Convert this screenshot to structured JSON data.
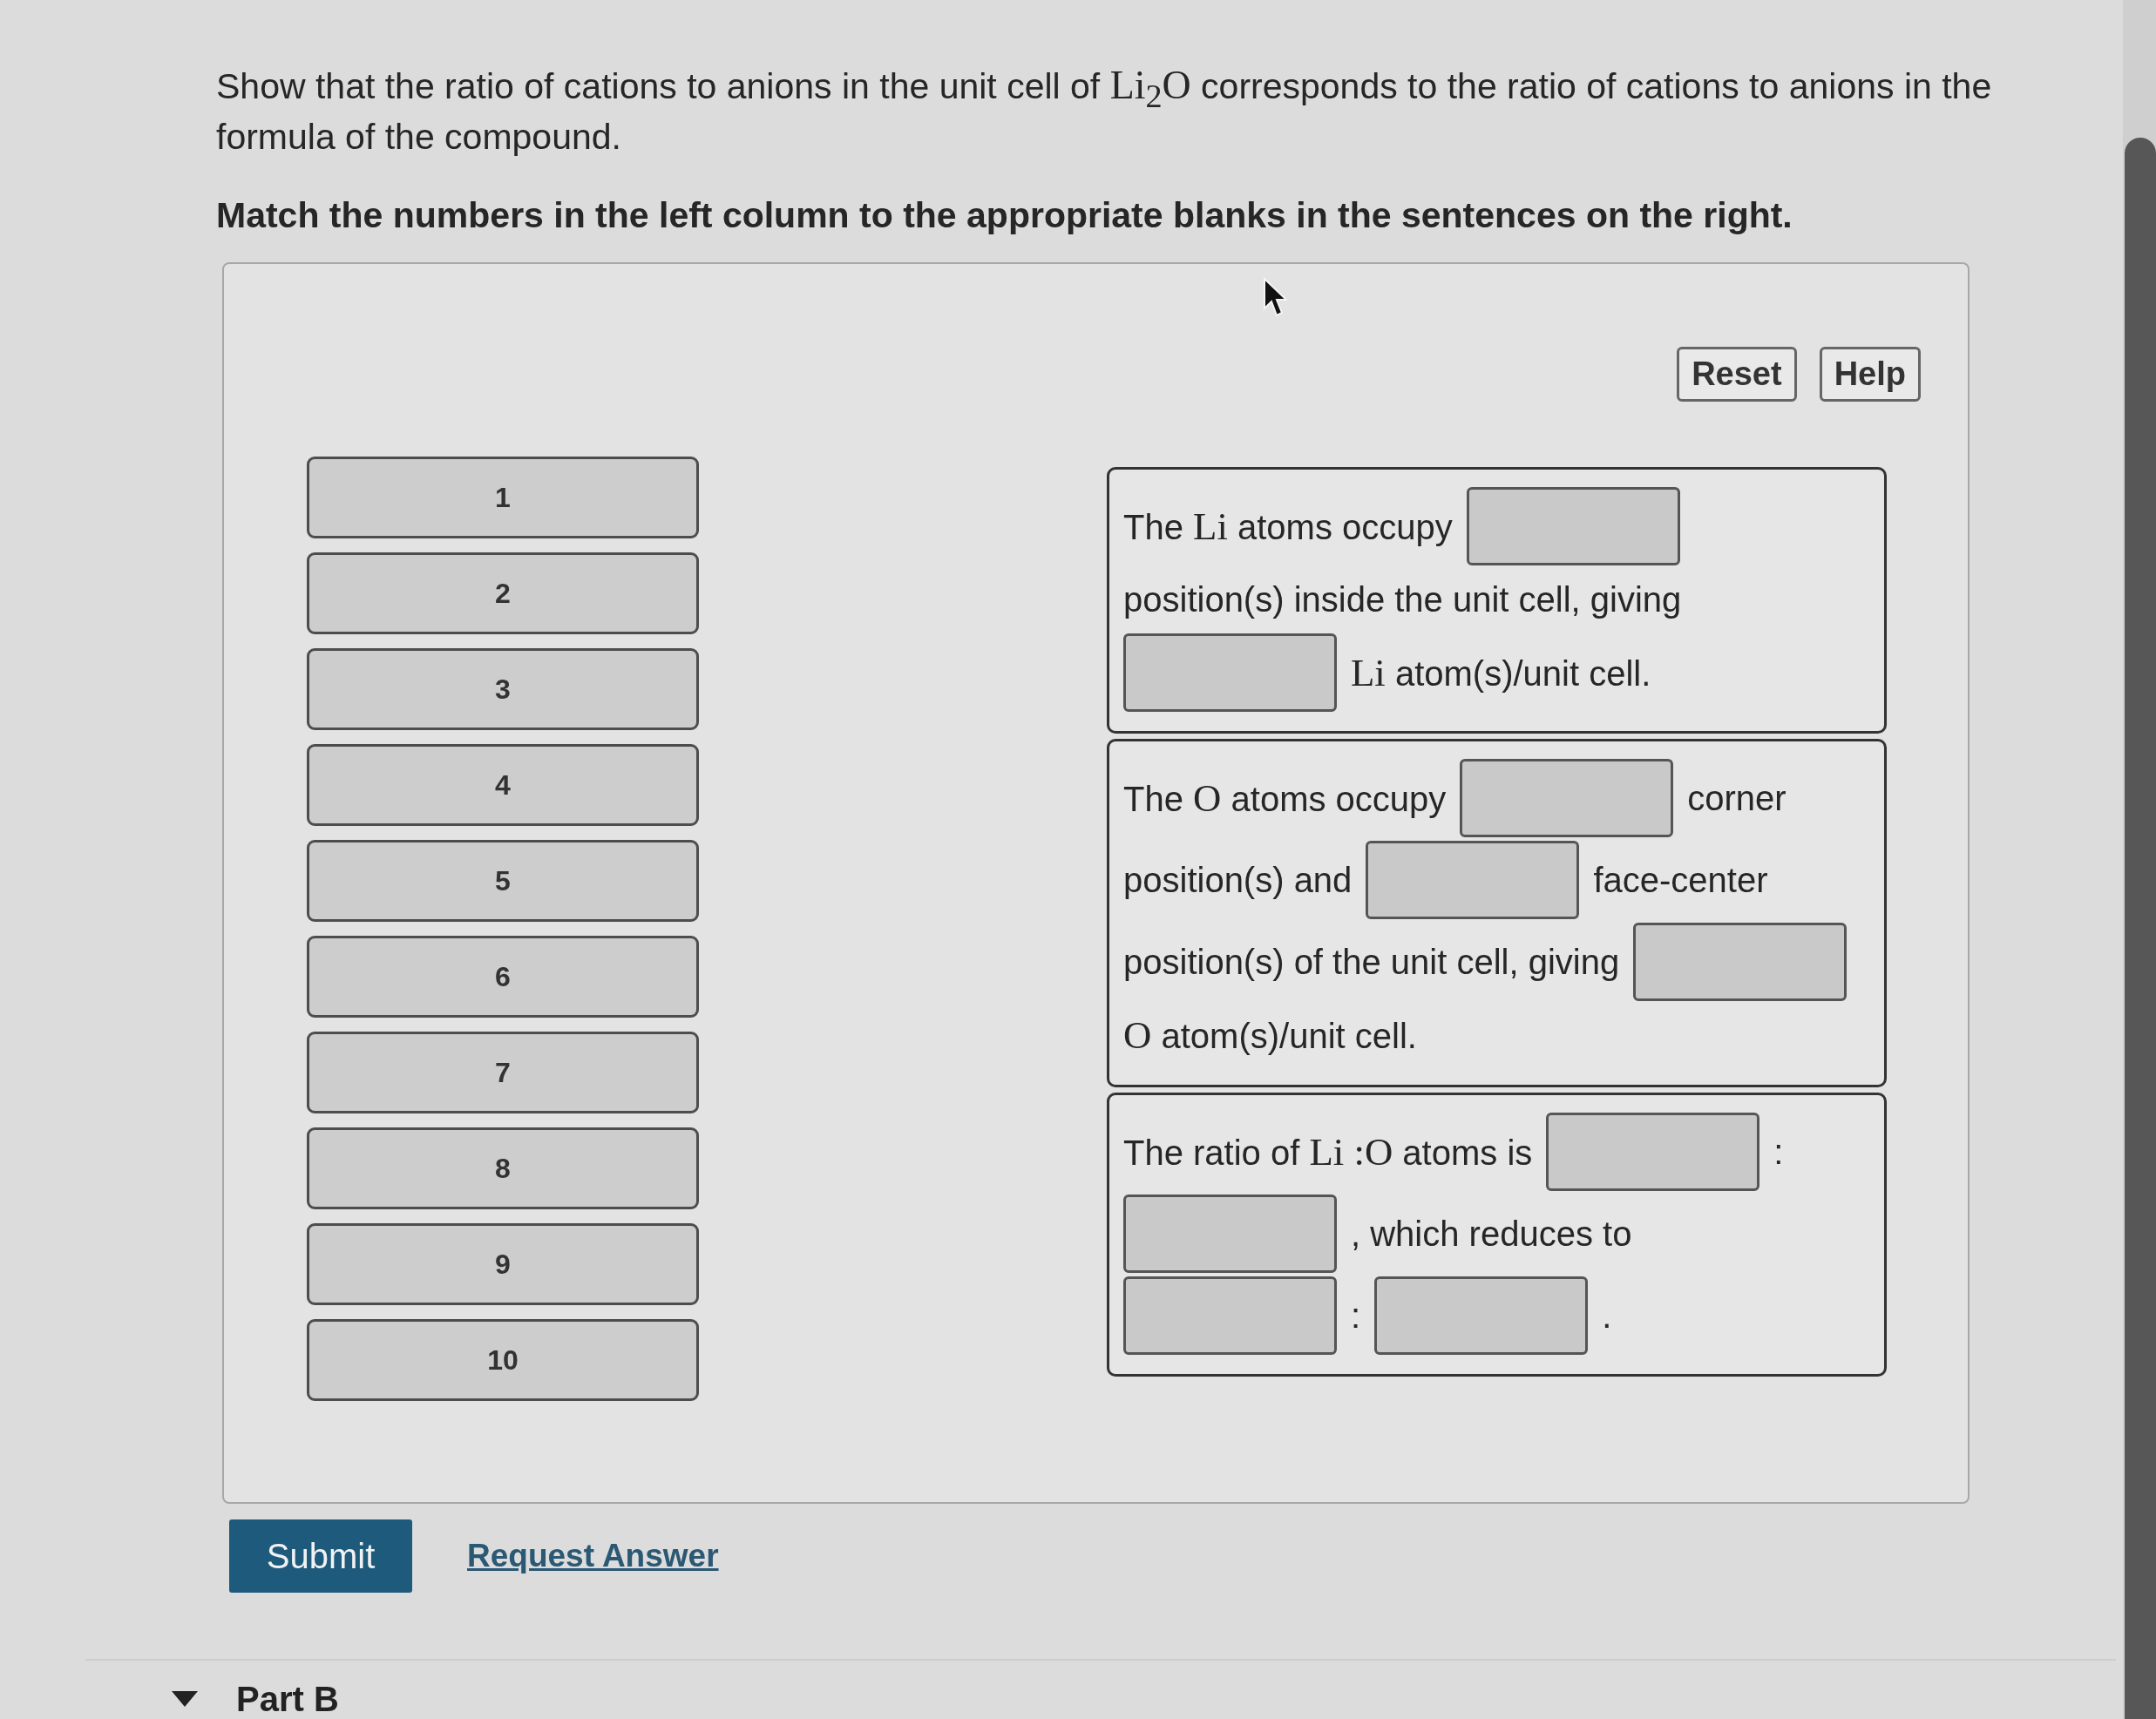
{
  "question": {
    "parts": [
      {
        "kind": "plain",
        "text": "Show that the ratio of cations to anions in the unit cell of "
      },
      {
        "kind": "math",
        "text": "Li$_{2}$O"
      },
      {
        "kind": "plain",
        "text": " corresponds to the ratio of cations to anions in the formula of the compound."
      }
    ]
  },
  "instruction": "Match the numbers in the left column to the appropriate blanks in the sentences on the right.",
  "tools": [
    "Reset",
    "Help"
  ],
  "tiles": [
    "1",
    "2",
    "3",
    "4",
    "5",
    "6",
    "7",
    "8",
    "9",
    "10"
  ],
  "sentences": [
    {
      "lines": [
        [
          {
            "kind": "text",
            "parts": [
              {
                "kind": "plain",
                "text": "The "
              },
              {
                "kind": "math",
                "text": "Li"
              },
              {
                "kind": "plain",
                "text": " atoms occupy"
              }
            ]
          },
          {
            "kind": "blank"
          }
        ],
        [
          {
            "kind": "text",
            "parts": [
              {
                "kind": "plain",
                "text": "position(s) inside the unit cell, giving"
              }
            ]
          }
        ],
        [
          {
            "kind": "blank"
          },
          {
            "kind": "text",
            "parts": [
              {
                "kind": "math",
                "text": "Li"
              },
              {
                "kind": "plain",
                "text": " atom(s)/unit cell."
              }
            ]
          }
        ]
      ]
    },
    {
      "lines": [
        [
          {
            "kind": "text",
            "parts": [
              {
                "kind": "plain",
                "text": "The "
              },
              {
                "kind": "math",
                "text": "O"
              },
              {
                "kind": "plain",
                "text": " atoms occupy"
              }
            ]
          },
          {
            "kind": "blank"
          },
          {
            "kind": "text",
            "parts": [
              {
                "kind": "plain",
                "text": "corner"
              }
            ]
          }
        ],
        [
          {
            "kind": "text",
            "parts": [
              {
                "kind": "plain",
                "text": "position(s) and"
              }
            ]
          },
          {
            "kind": "blank"
          },
          {
            "kind": "text",
            "parts": [
              {
                "kind": "plain",
                "text": "face-center"
              }
            ]
          }
        ],
        [
          {
            "kind": "text",
            "parts": [
              {
                "kind": "plain",
                "text": "position(s) of the unit cell, giving"
              }
            ]
          },
          {
            "kind": "blank"
          }
        ],
        [
          {
            "kind": "text",
            "parts": [
              {
                "kind": "math",
                "text": "O"
              },
              {
                "kind": "plain",
                "text": " atom(s)/unit cell."
              }
            ]
          }
        ]
      ]
    },
    {
      "lines": [
        [
          {
            "kind": "text",
            "parts": [
              {
                "kind": "plain",
                "text": "The ratio of "
              },
              {
                "kind": "math",
                "text": "Li :O"
              },
              {
                "kind": "plain",
                "text": " atoms is"
              }
            ]
          },
          {
            "kind": "blank"
          },
          {
            "kind": "text",
            "parts": [
              {
                "kind": "plain",
                "text": ":"
              }
            ]
          }
        ],
        [
          {
            "kind": "blank"
          },
          {
            "kind": "text",
            "parts": [
              {
                "kind": "plain",
                "text": ", which reduces to"
              }
            ]
          }
        ],
        [
          {
            "kind": "blank"
          },
          {
            "kind": "text",
            "parts": [
              {
                "kind": "plain",
                "text": ":"
              }
            ]
          },
          {
            "kind": "blank"
          },
          {
            "kind": "text",
            "parts": [
              {
                "kind": "plain",
                "text": "."
              }
            ]
          }
        ]
      ]
    }
  ],
  "actions": {
    "submit": "Submit",
    "request_answer": "Request Answer"
  },
  "next_part": {
    "label": "Part B"
  }
}
